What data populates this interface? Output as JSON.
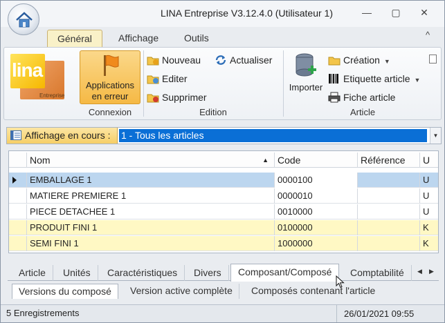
{
  "window": {
    "title": "LINA Entreprise  V3.12.4.0  (Utilisateur 1)",
    "min_glyph": "—",
    "max_glyph": "▢",
    "close_glyph": "✕"
  },
  "ribbon_tabs": [
    "Général",
    "Affichage",
    "Outils"
  ],
  "ribbon_collapse_glyph": "^",
  "logo": {
    "text": "lina",
    "subtext": "Entreprise"
  },
  "connexion": {
    "button_line1": "Applications",
    "button_line2": "en erreur",
    "group_label": "Connexion"
  },
  "edition": {
    "nouveau": "Nouveau",
    "editer": "Editer",
    "supprimer": "Supprimer",
    "actualiser": "Actualiser",
    "group_label": "Edition"
  },
  "article": {
    "importer": "Importer",
    "creation": "Création",
    "etiquette": "Etiquette article",
    "fiche": "Fiche article",
    "group_label": "Article"
  },
  "display": {
    "label": "Affichage en cours :",
    "value": "1 - Tous les articles"
  },
  "grid": {
    "columns": [
      "Nom",
      "Code",
      "Référence",
      "U"
    ],
    "rows": [
      {
        "nom": "EMBALLAGE 1",
        "code": "0000100",
        "reference": "",
        "u": "U"
      },
      {
        "nom": "MATIERE PREMIERE 1",
        "code": "0000010",
        "reference": "",
        "u": "U"
      },
      {
        "nom": "PIECE DETACHEE 1",
        "code": "0010000",
        "reference": "",
        "u": "U"
      },
      {
        "nom": "PRODUIT FINI 1",
        "code": "0100000",
        "reference": "",
        "u": "K"
      },
      {
        "nom": "SEMI FINI 1",
        "code": "1000000",
        "reference": "",
        "u": "K"
      }
    ]
  },
  "tabs": [
    "Article",
    "Unités",
    "Caractéristiques",
    "Divers",
    "Composant/Composé",
    "Comptabilité"
  ],
  "subtabs": [
    "Versions du composé",
    "Version active complète",
    "Composés contenant l'article"
  ],
  "status": {
    "records": "5 Enregistrements",
    "datetime": "26/01/2021 09:55"
  },
  "colors": {
    "selection": "#0a6fd6",
    "row_selected": "#bcd6ef",
    "row_highlight": "#fff8c4",
    "accent_orange": "#f5b945"
  }
}
